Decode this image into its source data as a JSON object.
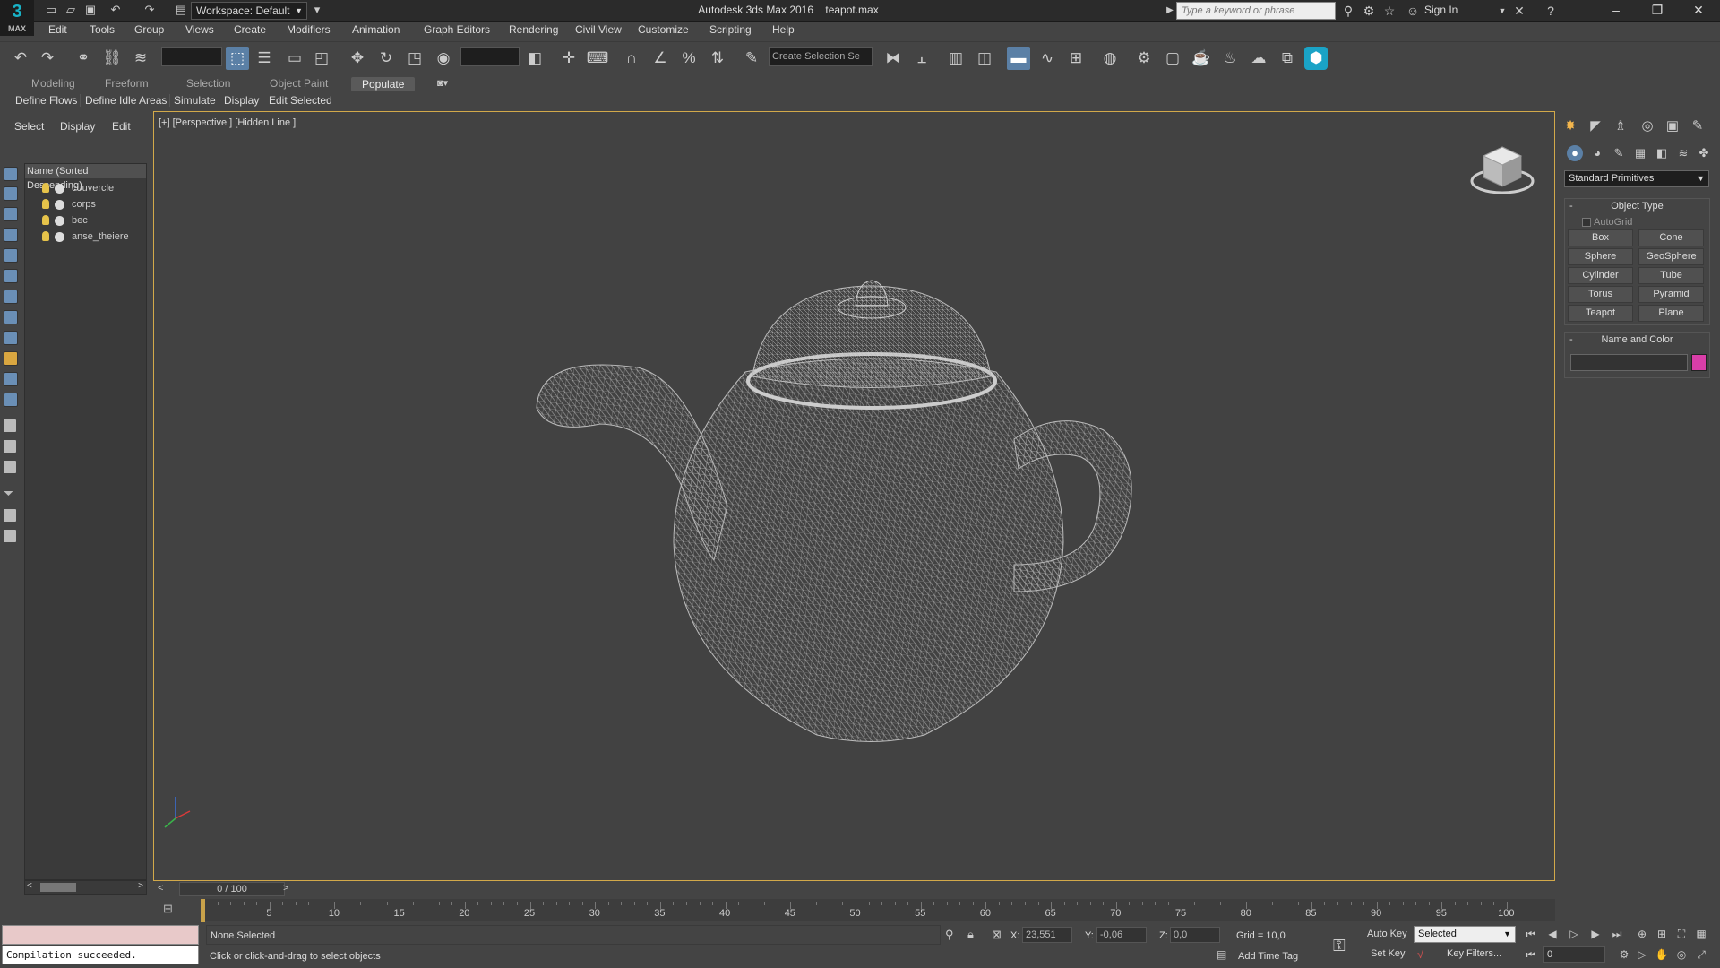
{
  "app": {
    "title": "Autodesk 3ds Max 2016",
    "file": "teapot.max",
    "logo_text": "3",
    "logo_sub": "MAX",
    "workspace": "Workspace: Default",
    "search_placeholder": "Type a keyword or phrase",
    "sign_in": "Sign In"
  },
  "menu": [
    "Edit",
    "Tools",
    "Group",
    "Views",
    "Create",
    "Modifiers",
    "Animation",
    "Graph Editors",
    "Rendering",
    "Civil View",
    "Customize",
    "Scripting",
    "Help"
  ],
  "toolbar": {
    "selection_set_placeholder": "Create Selection Se"
  },
  "ribbon": {
    "tabs": [
      "Modeling",
      "Freeform",
      "Selection",
      "Object Paint",
      "Populate"
    ],
    "active_tab": "Populate",
    "sub": [
      "Define Flows",
      "Define Idle Areas",
      "Simulate",
      "Display",
      "Edit Selected"
    ]
  },
  "scene_explorer": {
    "tabs": [
      "Select",
      "Display",
      "Edit"
    ],
    "column_header": "Name (Sorted Descending)",
    "objects": [
      "couvercle",
      "corps",
      "bec",
      "anse_theiere"
    ]
  },
  "viewport": {
    "label": "[+] [Perspective ] [Hidden Line ]"
  },
  "command_panel": {
    "dropdown": "Standard Primitives",
    "object_type_title": "Object Type",
    "autogrid": "AutoGrid",
    "primitives": [
      "Box",
      "Cone",
      "Sphere",
      "GeoSphere",
      "Cylinder",
      "Tube",
      "Torus",
      "Pyramid",
      "Teapot",
      "Plane"
    ],
    "name_color_title": "Name and Color",
    "object_color": "#d93ea8"
  },
  "timeline": {
    "slider": "0 / 100",
    "ticks": [
      "5",
      "10",
      "15",
      "20",
      "25",
      "30",
      "35",
      "40",
      "45",
      "50",
      "55",
      "60",
      "65",
      "70",
      "75",
      "80",
      "85",
      "90",
      "95",
      "100"
    ]
  },
  "status": {
    "maxscript": "Compilation succeeded.",
    "selection": "None Selected",
    "prompt": "Click or click-and-drag to select objects",
    "x_label": "X:",
    "x": "23,551",
    "y_label": "Y:",
    "y": "-0,06",
    "z_label": "Z:",
    "z": "0,0",
    "grid": "Grid = 10,0",
    "add_time_tag": "Add Time Tag",
    "auto_key": "Auto Key",
    "set_key": "Set Key",
    "selected": "Selected",
    "key_filters": "Key Filters...",
    "frame": "0"
  }
}
